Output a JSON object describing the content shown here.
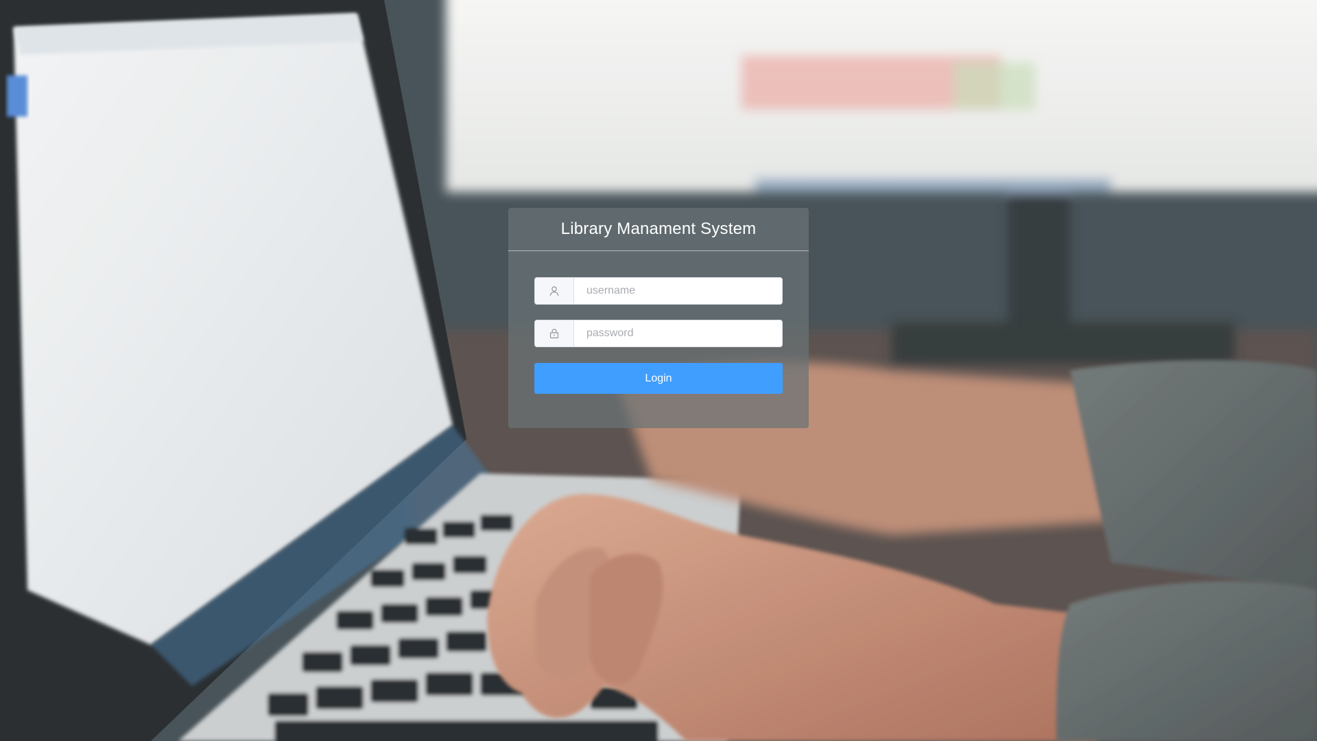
{
  "app": {
    "title": "Library Manament System"
  },
  "login_form": {
    "username_placeholder": "username",
    "username_value": "",
    "username_icon": "user-icon",
    "password_placeholder": "password",
    "password_value": "",
    "password_icon": "lock-icon",
    "submit_label": "Login"
  },
  "colors": {
    "primary": "#409eff",
    "panel_background": "rgba(105,115,118,0.72)",
    "title_text": "#ffffff"
  }
}
